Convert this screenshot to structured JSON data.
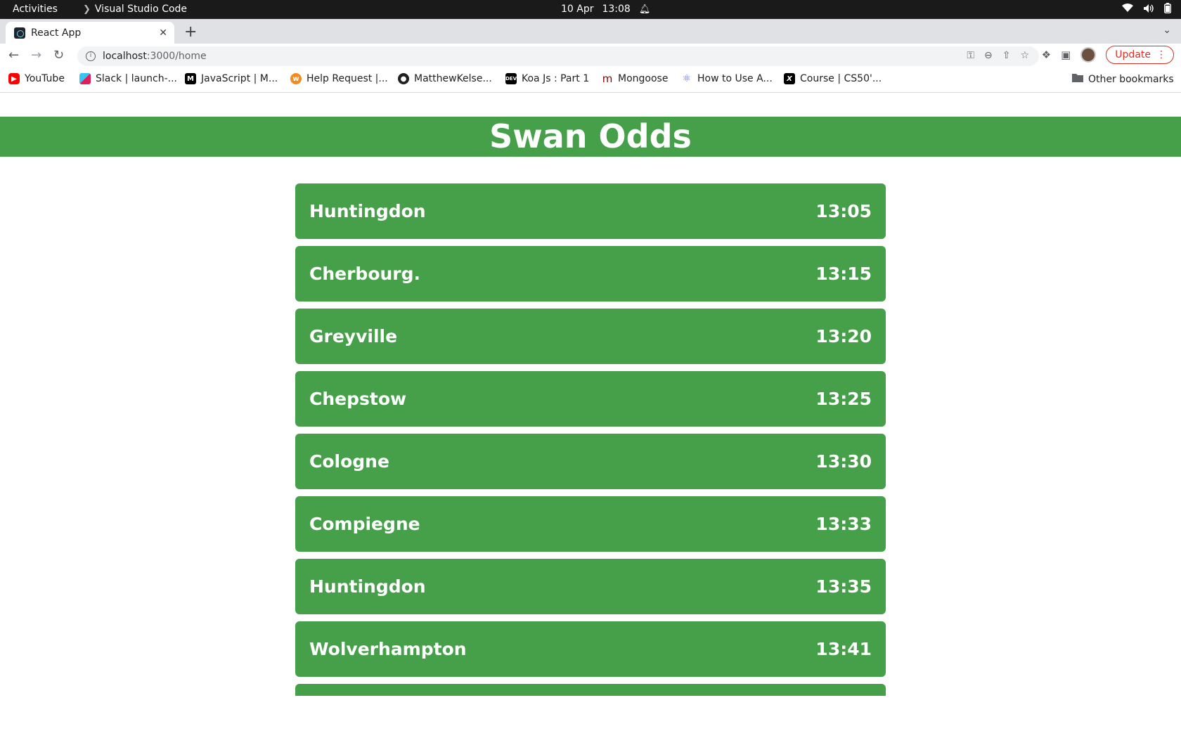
{
  "system_bar": {
    "activities": "Activities",
    "app_name": "Visual Studio Code",
    "date": "10 Apr",
    "time": "13:08"
  },
  "browser": {
    "tab_title": "React App",
    "url_host": "localhost",
    "url_rest": ":3000/home",
    "update_label": "Update",
    "bookmarks": [
      {
        "label": "YouTube",
        "icon": "youtube-icon"
      },
      {
        "label": "Slack | launch-...",
        "icon": "slack-icon"
      },
      {
        "label": "JavaScript | M...",
        "icon": "mdn-icon"
      },
      {
        "label": "Help Request |...",
        "icon": "help-icon"
      },
      {
        "label": "MatthewKelse...",
        "icon": "github-icon"
      },
      {
        "label": "Koa Js : Part 1",
        "icon": "dev-icon"
      },
      {
        "label": "Mongoose",
        "icon": "mongoose-icon"
      },
      {
        "label": "How to Use A...",
        "icon": "react-icon"
      },
      {
        "label": "Course | CS50'...",
        "icon": "edx-icon"
      }
    ],
    "other_bookmarks": "Other bookmarks"
  },
  "app": {
    "title": "Swan Odds",
    "races": [
      {
        "venue": "Huntingdon",
        "time": "13:05"
      },
      {
        "venue": "Cherbourg.",
        "time": "13:15"
      },
      {
        "venue": "Greyville",
        "time": "13:20"
      },
      {
        "venue": "Chepstow",
        "time": "13:25"
      },
      {
        "venue": "Cologne",
        "time": "13:30"
      },
      {
        "venue": "Compiegne",
        "time": "13:33"
      },
      {
        "venue": "Huntingdon",
        "time": "13:35"
      },
      {
        "venue": "Wolverhampton",
        "time": "13:41"
      },
      {
        "venue": "",
        "time": ""
      }
    ]
  },
  "colors": {
    "brand_green": "#46a049",
    "update_red": "#d93025"
  }
}
